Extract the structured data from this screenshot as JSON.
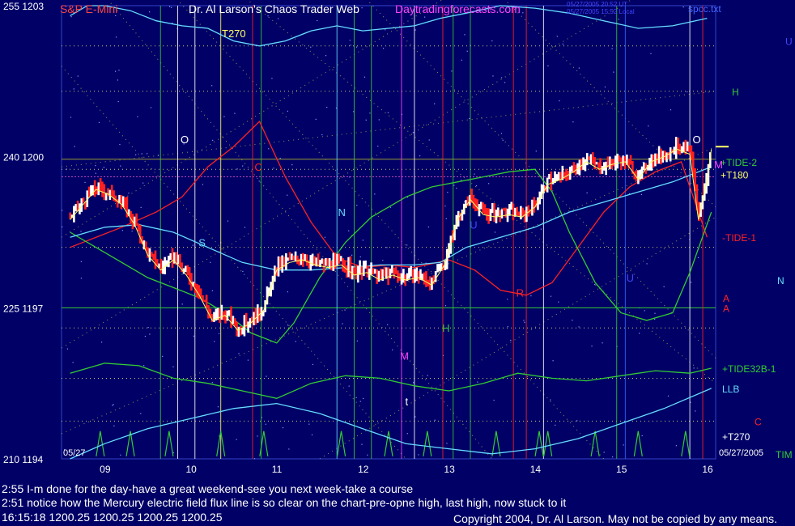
{
  "header": {
    "symbol": "S&P E-Mini",
    "title": "Dr. Al Larson's Chaos Trader Web",
    "site": "Daytradingforecasts.com",
    "file": "spcc.txt",
    "stamp1": "05/27/2005 20:52 UT",
    "stamp2": "05/27/2005 15:52 Local"
  },
  "colors": {
    "background": "#000066",
    "bars_up": "#ffffff",
    "bars_down": "#ff2020",
    "green_lines": "#33cc33",
    "red_lines": "#ff2222",
    "cyan_lines": "#66ddff",
    "yellow_lines": "#ffff66",
    "title_red": "#ff4444",
    "site_magenta": "#ff44ff"
  },
  "chart_data": {
    "type": "bar",
    "title": "Dr. Al Larson's Chaos Trader Web",
    "ylim": [
      1194,
      1203
    ],
    "xlim": [
      8.5,
      16.1
    ],
    "y_ticks": [
      {
        "price": "1203",
        "alt": "255",
        "v": 1203
      },
      {
        "price": "1200",
        "alt": "240",
        "v": 1200
      },
      {
        "price": "1197",
        "alt": "225",
        "v": 1197
      },
      {
        "price": "1194",
        "alt": "210",
        "v": 1194
      }
    ],
    "x_ticks": [
      "09",
      "10",
      "11",
      "12",
      "13",
      "14",
      "15",
      "16"
    ],
    "x_tick_values": [
      9,
      10,
      11,
      12,
      13,
      14,
      15,
      16
    ],
    "date_left": "05/27",
    "date_right": "05/27/2005",
    "right_labels": [
      {
        "text": "U",
        "v": 1202.3,
        "color": "#4444ff"
      },
      {
        "text": "H",
        "v": 1201.3,
        "color": "#33cc33"
      },
      {
        "text": "+TIDE-2",
        "v": 1199.9,
        "color": "#33cc33"
      },
      {
        "text": "+T180",
        "v": 1199.65,
        "color": "#ffff66"
      },
      {
        "text": "-TIDE-1",
        "v": 1198.4,
        "color": "#ff2222"
      },
      {
        "text": "N",
        "v": 1197.55,
        "color": "#66ddff"
      },
      {
        "text": "A",
        "v": 1197.2,
        "color": "#ff2222"
      },
      {
        "text": "A",
        "v": 1197.0,
        "color": "#ff2222"
      },
      {
        "text": "+TIDE32B-1",
        "v": 1195.8,
        "color": "#33cc33"
      },
      {
        "text": "LLB",
        "v": 1195.4,
        "color": "#66ddff"
      },
      {
        "text": "C",
        "v": 1194.75,
        "color": "#ff2222"
      },
      {
        "text": "+T270",
        "v": 1194.45,
        "color": "#ffffff"
      },
      {
        "text": "TIM",
        "v": 1194.1,
        "color": "#33cc33"
      }
    ],
    "annotations": [
      {
        "text": "T270",
        "x": 10.4,
        "v": 1202.45,
        "color": "#ffff66"
      },
      {
        "text": "O",
        "x": 9.92,
        "v": 1200.35,
        "color": "#ffffff"
      },
      {
        "text": "C",
        "x": 10.78,
        "v": 1199.8,
        "color": "#ff2222"
      },
      {
        "text": "N",
        "x": 11.75,
        "v": 1198.9,
        "color": "#66ddff"
      },
      {
        "text": "S",
        "x": 10.13,
        "v": 1198.3,
        "color": "#66ddff"
      },
      {
        "text": "U",
        "x": 13.28,
        "v": 1198.65,
        "color": "#4444ff"
      },
      {
        "text": "U",
        "x": 15.1,
        "v": 1197.6,
        "color": "#4444ff"
      },
      {
        "text": "R",
        "x": 13.82,
        "v": 1197.3,
        "color": "#ff2222"
      },
      {
        "text": "H",
        "x": 12.96,
        "v": 1196.6,
        "color": "#33cc33"
      },
      {
        "text": "M",
        "x": 12.47,
        "v": 1196.05,
        "color": "#ff44ff"
      },
      {
        "text": "t",
        "x": 12.53,
        "v": 1195.15,
        "color": "#ffffff"
      },
      {
        "text": "O",
        "x": 15.87,
        "v": 1200.35,
        "color": "#ffffff"
      },
      {
        "text": "M",
        "x": 16.12,
        "v": 1199.85,
        "color": "#ff44ff"
      }
    ],
    "price_path": [
      [
        8.6,
        1198.8
      ],
      [
        8.75,
        1199.1
      ],
      [
        8.9,
        1199.4
      ],
      [
        9.05,
        1199.3
      ],
      [
        9.2,
        1199.1
      ],
      [
        9.35,
        1198.7
      ],
      [
        9.5,
        1198.1
      ],
      [
        9.65,
        1197.8
      ],
      [
        9.8,
        1198.0
      ],
      [
        9.95,
        1197.7
      ],
      [
        10.1,
        1197.3
      ],
      [
        10.25,
        1196.8
      ],
      [
        10.4,
        1196.9
      ],
      [
        10.55,
        1196.6
      ],
      [
        10.7,
        1196.75
      ],
      [
        10.85,
        1197.0
      ],
      [
        11.0,
        1197.8
      ],
      [
        11.15,
        1197.95
      ],
      [
        11.3,
        1198.0
      ],
      [
        11.45,
        1197.9
      ],
      [
        11.6,
        1197.85
      ],
      [
        11.75,
        1197.9
      ],
      [
        11.9,
        1197.7
      ],
      [
        12.05,
        1197.75
      ],
      [
        12.2,
        1197.6
      ],
      [
        12.35,
        1197.7
      ],
      [
        12.5,
        1197.6
      ],
      [
        12.65,
        1197.65
      ],
      [
        12.8,
        1197.5
      ],
      [
        12.95,
        1197.9
      ],
      [
        13.1,
        1198.8
      ],
      [
        13.25,
        1199.2
      ],
      [
        13.4,
        1198.9
      ],
      [
        13.55,
        1198.85
      ],
      [
        13.7,
        1198.9
      ],
      [
        13.85,
        1198.85
      ],
      [
        14.0,
        1199.05
      ],
      [
        14.15,
        1199.5
      ],
      [
        14.3,
        1199.6
      ],
      [
        14.45,
        1199.75
      ],
      [
        14.6,
        1199.95
      ],
      [
        14.75,
        1199.8
      ],
      [
        14.9,
        1199.9
      ],
      [
        15.05,
        1199.95
      ],
      [
        15.2,
        1199.6
      ],
      [
        15.35,
        1199.95
      ],
      [
        15.5,
        1200.05
      ],
      [
        15.65,
        1200.2
      ],
      [
        15.8,
        1200.1
      ],
      [
        15.9,
        1198.8
      ],
      [
        16.0,
        1199.6
      ],
      [
        16.05,
        1200.2
      ]
    ],
    "series": [
      {
        "color": "#ff2222",
        "points": [
          [
            8.6,
            1198.2
          ],
          [
            9.2,
            1198.6
          ],
          [
            9.6,
            1198.9
          ],
          [
            9.9,
            1199.2
          ],
          [
            10.2,
            1199.8
          ],
          [
            10.5,
            1200.2
          ],
          [
            10.8,
            1200.7
          ],
          [
            11.1,
            1199.6
          ],
          [
            11.4,
            1198.7
          ],
          [
            11.7,
            1198.0
          ],
          [
            12.0,
            1197.8
          ],
          [
            12.3,
            1197.85
          ],
          [
            12.6,
            1197.8
          ],
          [
            13.0,
            1197.95
          ],
          [
            13.3,
            1197.75
          ],
          [
            13.6,
            1197.35
          ],
          [
            13.9,
            1197.25
          ],
          [
            14.2,
            1197.5
          ],
          [
            14.5,
            1198.2
          ],
          [
            14.8,
            1198.9
          ],
          [
            15.1,
            1199.4
          ],
          [
            15.4,
            1199.7
          ],
          [
            15.7,
            1199.9
          ],
          [
            16.0,
            1198.4
          ]
        ]
      },
      {
        "color": "#33cc33",
        "points": [
          [
            8.6,
            1198.5
          ],
          [
            8.9,
            1198.2
          ],
          [
            9.2,
            1197.9
          ],
          [
            9.5,
            1197.6
          ],
          [
            9.8,
            1197.4
          ],
          [
            10.1,
            1197.2
          ],
          [
            10.4,
            1196.9
          ],
          [
            10.7,
            1196.5
          ],
          [
            11.0,
            1196.3
          ],
          [
            11.2,
            1196.7
          ],
          [
            11.5,
            1197.6
          ],
          [
            11.8,
            1198.3
          ],
          [
            12.1,
            1198.8
          ],
          [
            12.5,
            1199.2
          ],
          [
            12.8,
            1199.4
          ],
          [
            13.1,
            1199.5
          ],
          [
            13.4,
            1199.6
          ],
          [
            13.7,
            1199.7
          ],
          [
            14.0,
            1199.75
          ],
          [
            14.2,
            1199.3
          ],
          [
            14.4,
            1198.5
          ],
          [
            14.7,
            1197.5
          ],
          [
            15.0,
            1196.9
          ],
          [
            15.3,
            1196.75
          ],
          [
            15.6,
            1196.9
          ],
          [
            15.8,
            1197.7
          ],
          [
            16.05,
            1198.9
          ]
        ]
      },
      {
        "color": "#66ddff",
        "points": [
          [
            8.6,
            1198.4
          ],
          [
            9.0,
            1198.6
          ],
          [
            9.4,
            1198.65
          ],
          [
            9.8,
            1198.5
          ],
          [
            10.2,
            1198.2
          ],
          [
            10.6,
            1197.9
          ],
          [
            11.0,
            1197.75
          ],
          [
            11.4,
            1197.75
          ],
          [
            11.8,
            1197.8
          ],
          [
            12.2,
            1197.85
          ],
          [
            12.6,
            1197.85
          ],
          [
            12.9,
            1197.9
          ],
          [
            13.2,
            1198.2
          ],
          [
            13.6,
            1198.4
          ],
          [
            14.0,
            1198.6
          ],
          [
            14.4,
            1198.9
          ],
          [
            14.8,
            1199.1
          ],
          [
            15.2,
            1199.3
          ],
          [
            15.6,
            1199.5
          ],
          [
            16.05,
            1199.8
          ]
        ]
      },
      {
        "color": "#66ddff",
        "points": [
          [
            8.6,
            1202.8
          ],
          [
            8.8,
            1203.0
          ],
          [
            9.0,
            1203.0
          ],
          [
            9.3,
            1202.9
          ],
          [
            9.6,
            1202.7
          ],
          [
            9.9,
            1202.6
          ],
          [
            10.2,
            1202.55
          ],
          [
            10.5,
            1202.3
          ],
          [
            10.8,
            1202.2
          ],
          [
            11.1,
            1202.3
          ],
          [
            11.4,
            1202.5
          ],
          [
            11.7,
            1202.6
          ],
          [
            12.0,
            1202.5
          ],
          [
            12.3,
            1202.55
          ],
          [
            12.6,
            1202.6
          ],
          [
            12.9,
            1202.75
          ],
          [
            13.2,
            1202.85
          ],
          [
            13.6,
            1203.0
          ],
          [
            14.0,
            1202.95
          ],
          [
            14.4,
            1202.85
          ],
          [
            14.8,
            1202.7
          ],
          [
            15.2,
            1202.55
          ],
          [
            15.6,
            1202.6
          ],
          [
            16.0,
            1202.75
          ]
        ]
      },
      {
        "color": "#66ddff",
        "points": [
          [
            8.6,
            1194.0
          ],
          [
            9.0,
            1194.3
          ],
          [
            9.5,
            1194.6
          ],
          [
            10.0,
            1194.8
          ],
          [
            10.5,
            1195.0
          ],
          [
            11.0,
            1195.1
          ],
          [
            11.5,
            1194.9
          ],
          [
            12.0,
            1194.6
          ],
          [
            12.5,
            1194.3
          ],
          [
            13.0,
            1194.2
          ],
          [
            13.5,
            1194.1
          ],
          [
            14.0,
            1194.2
          ],
          [
            14.5,
            1194.4
          ],
          [
            15.0,
            1194.7
          ],
          [
            15.5,
            1195.0
          ],
          [
            16.05,
            1195.4
          ]
        ]
      },
      {
        "color": "#33cc33",
        "points": [
          [
            8.6,
            1195.7
          ],
          [
            9.0,
            1195.9
          ],
          [
            9.4,
            1195.85
          ],
          [
            9.8,
            1195.6
          ],
          [
            10.2,
            1195.5
          ],
          [
            10.6,
            1195.35
          ],
          [
            11.0,
            1195.2
          ],
          [
            11.4,
            1195.5
          ],
          [
            11.8,
            1195.65
          ],
          [
            12.2,
            1195.6
          ],
          [
            12.6,
            1195.45
          ],
          [
            13.0,
            1195.35
          ],
          [
            13.4,
            1195.5
          ],
          [
            13.8,
            1195.7
          ],
          [
            14.2,
            1195.6
          ],
          [
            14.6,
            1195.55
          ],
          [
            15.0,
            1195.65
          ],
          [
            15.4,
            1195.75
          ],
          [
            15.8,
            1195.7
          ],
          [
            16.05,
            1195.8
          ]
        ]
      }
    ]
  },
  "status": {
    "line1": "2:55 I-m done for the day-have a great weekend-see you next week-take a course",
    "line2": "2:51 notice how the Mercury electric field flux line is so clear on the chart-pre-opne high, last high, now stuck to it",
    "line3": "16:15:18  1200.25 1200.25 1200.25 1200.25",
    "copyright": "Copyright 2004, Dr. Al Larson. May not be copied by any means."
  }
}
